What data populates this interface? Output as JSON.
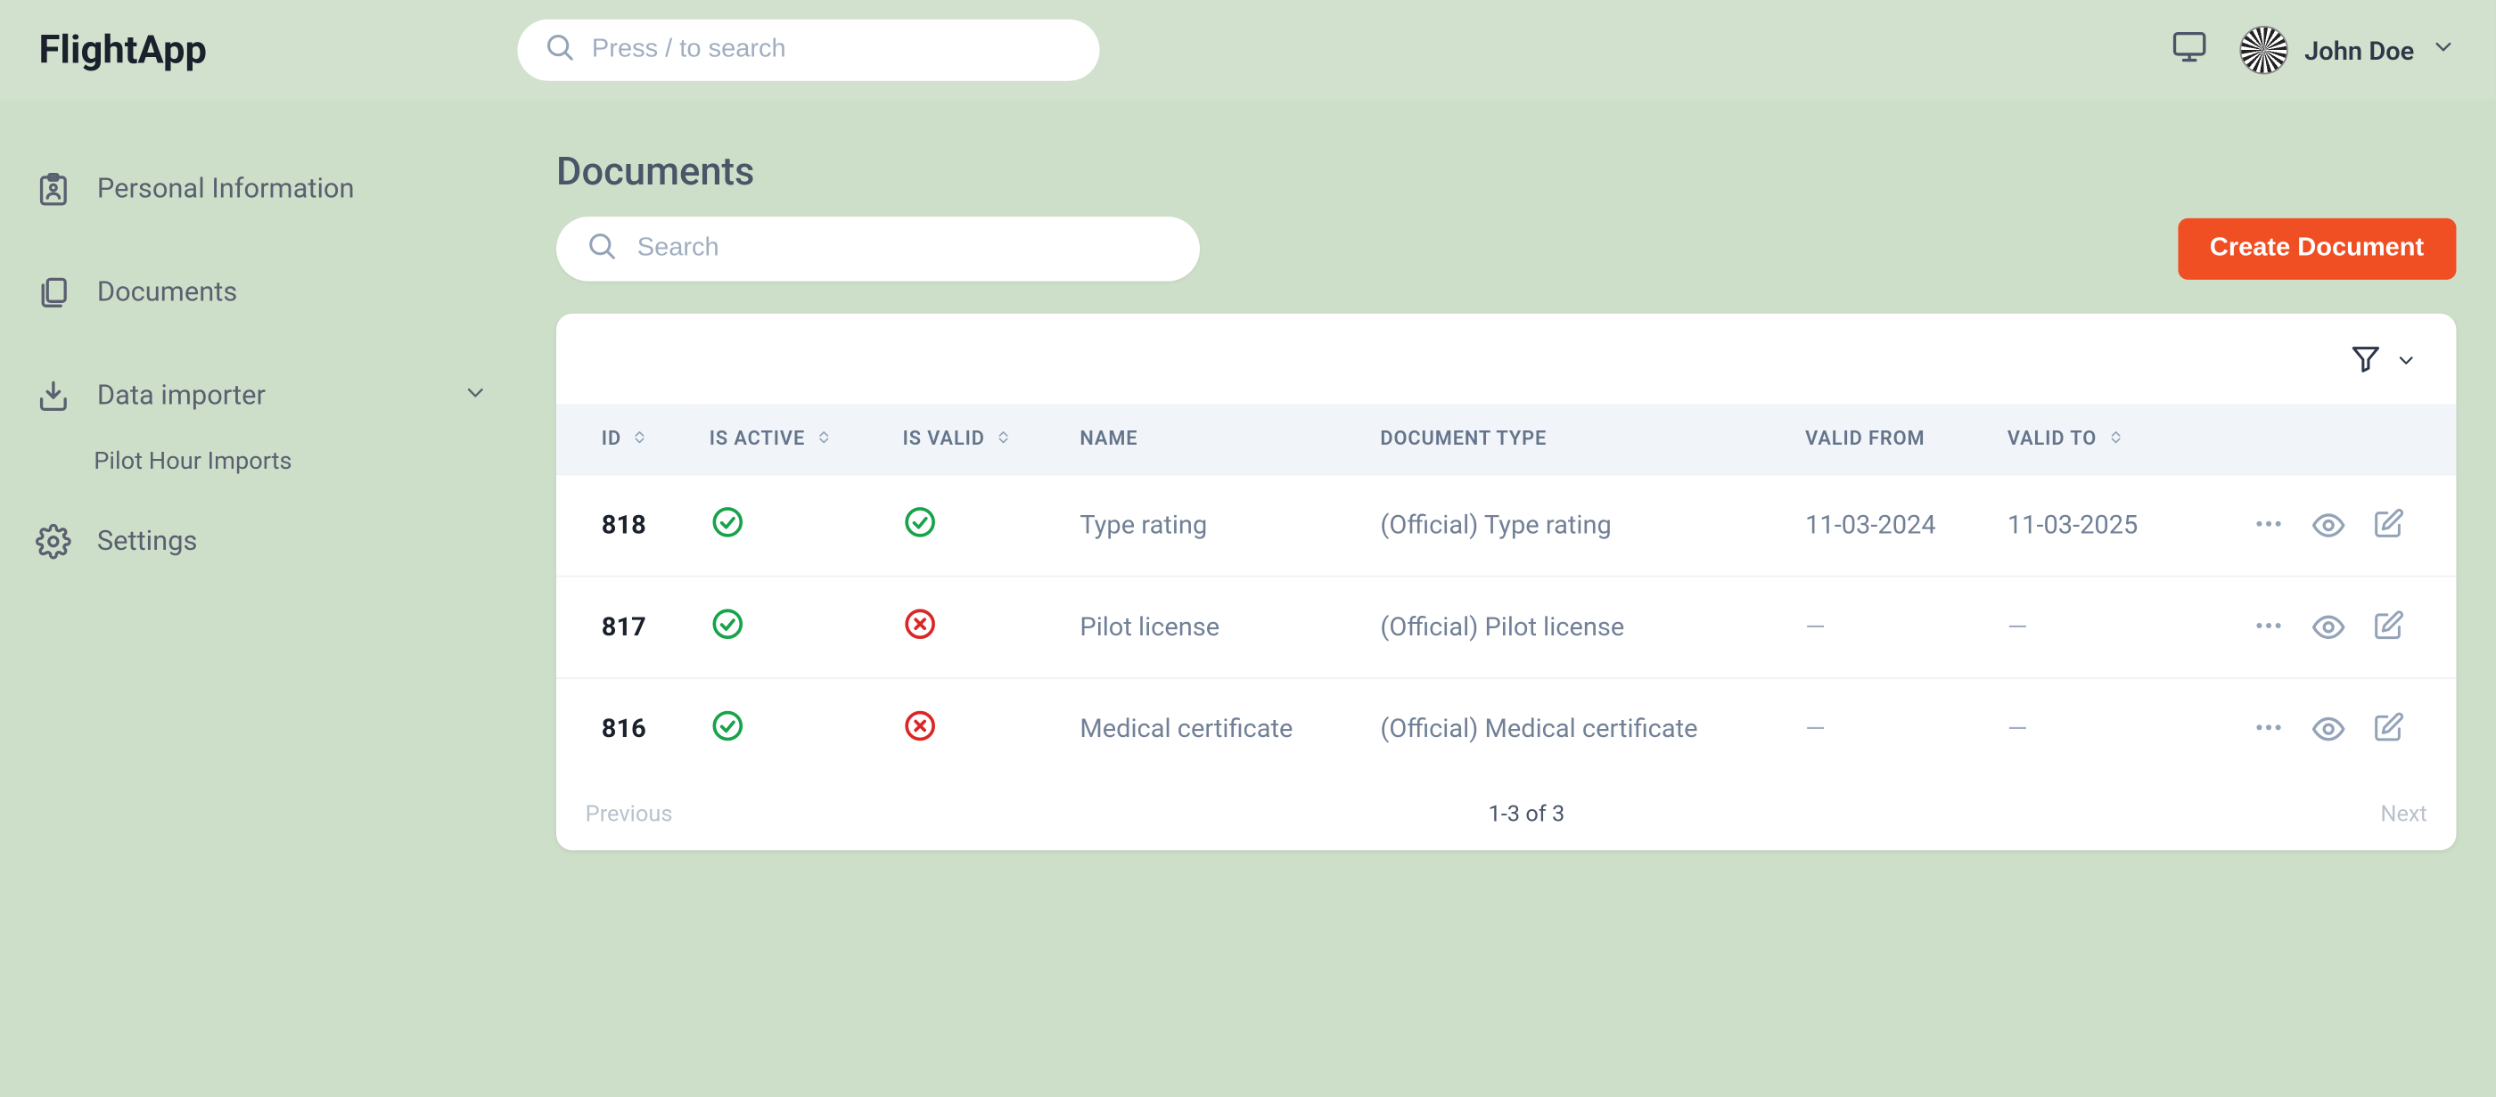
{
  "brand": "FlightApp",
  "search": {
    "placeholder": "Press / to search"
  },
  "user": {
    "name": "John Doe"
  },
  "sidebar": {
    "personal_info": "Personal Information",
    "documents": "Documents",
    "data_importer": "Data importer",
    "pilot_hour_imports": "Pilot Hour Imports",
    "settings": "Settings"
  },
  "page": {
    "title": "Documents",
    "filter_placeholder": "Search",
    "create_button": "Create Document"
  },
  "table": {
    "columns": {
      "id": "ID",
      "is_active": "IS ACTIVE",
      "is_valid": "IS VALID",
      "name": "NAME",
      "document_type": "DOCUMENT TYPE",
      "valid_from": "VALID FROM",
      "valid_to": "VALID TO"
    },
    "rows": [
      {
        "id": "818",
        "is_active": true,
        "is_valid": true,
        "name": "Type rating",
        "document_type": "(Official) Type rating",
        "valid_from": "11-03-2024",
        "valid_to": "11-03-2025"
      },
      {
        "id": "817",
        "is_active": true,
        "is_valid": false,
        "name": "Pilot license",
        "document_type": "(Official) Pilot license",
        "valid_from": "—",
        "valid_to": "—"
      },
      {
        "id": "816",
        "is_active": true,
        "is_valid": false,
        "name": "Medical certificate",
        "document_type": "(Official) Medical certificate",
        "valid_from": "—",
        "valid_to": "—"
      }
    ]
  },
  "pager": {
    "previous": "Previous",
    "range": "1-3 of 3",
    "next": "Next"
  }
}
